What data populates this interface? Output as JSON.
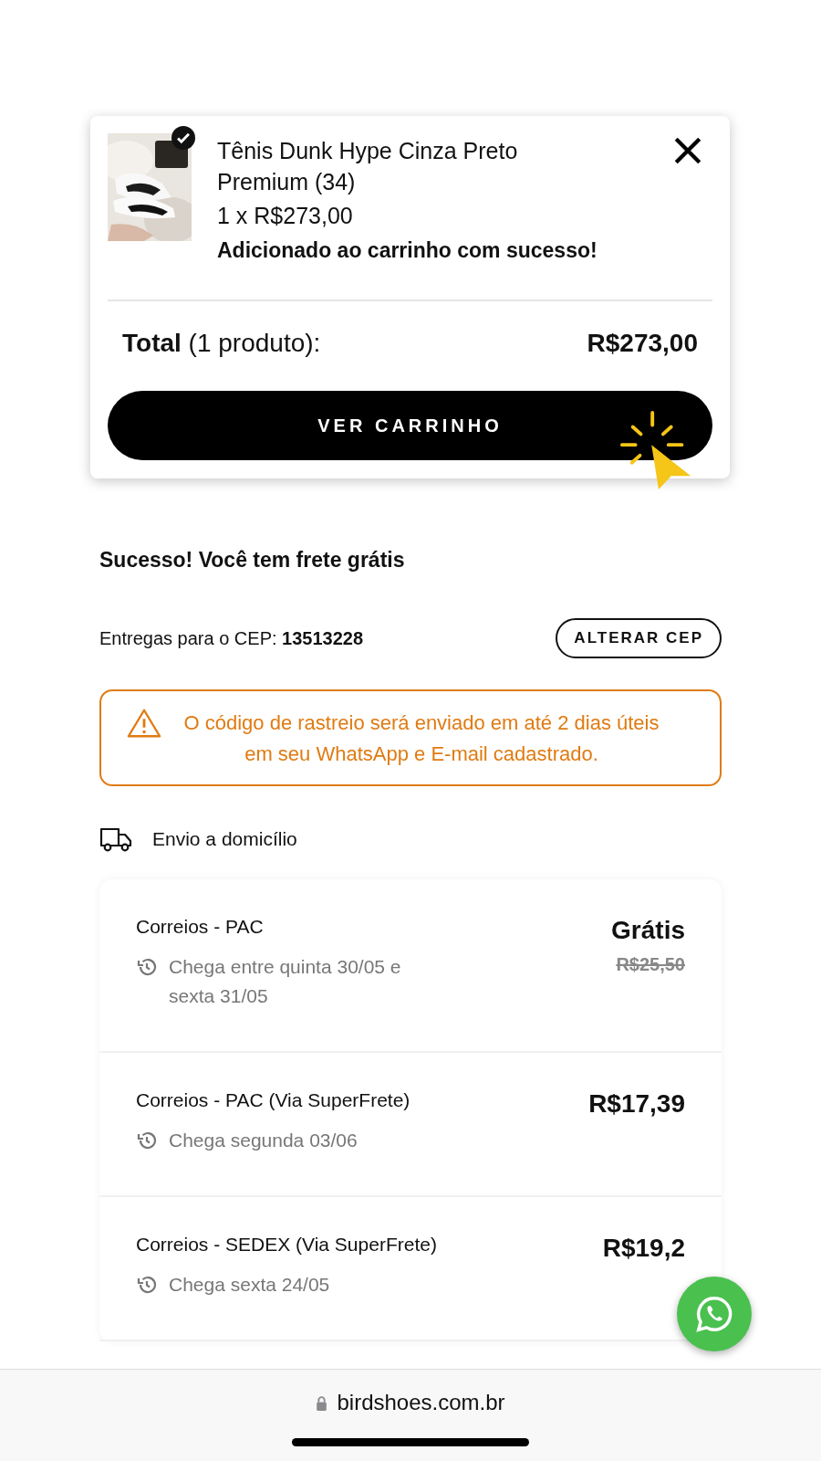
{
  "popup": {
    "product_name": "Tênis Dunk Hype Cinza Preto Premium (34)",
    "quantity_price": "1 x R$273,00",
    "message": "Adicionado ao carrinho com sucesso!",
    "total_label": "**Total** (1 produto):",
    "total_value": "R$273,00",
    "button": "VER CARRINHO"
  },
  "shipping": {
    "heading": "Sucesso! Você tem frete grátis",
    "cep_label": "Entregas para o CEP: **13513228**",
    "change_button": "ALTERAR CEP",
    "notice": "O código de rastreio será enviado em até 2 dias úteis em seu WhatsApp e E-mail cadastrado.",
    "method": "Envio a domicílio",
    "options": [
      {
        "name": "Correios - PAC",
        "eta": "Chega entre quinta 30/05 e sexta 31/05",
        "price": "Grátis",
        "old_price": "R$25,50"
      },
      {
        "name": "Correios - PAC (Via SuperFrete)",
        "eta": "Chega segunda 03/06",
        "price": "R$17,39"
      },
      {
        "name": "Correios - SEDEX (Via SuperFrete)",
        "eta": "Chega sexta 24/05",
        "price": "R$19,2"
      }
    ]
  },
  "browser": {
    "url": "birdshoes.com.br"
  }
}
